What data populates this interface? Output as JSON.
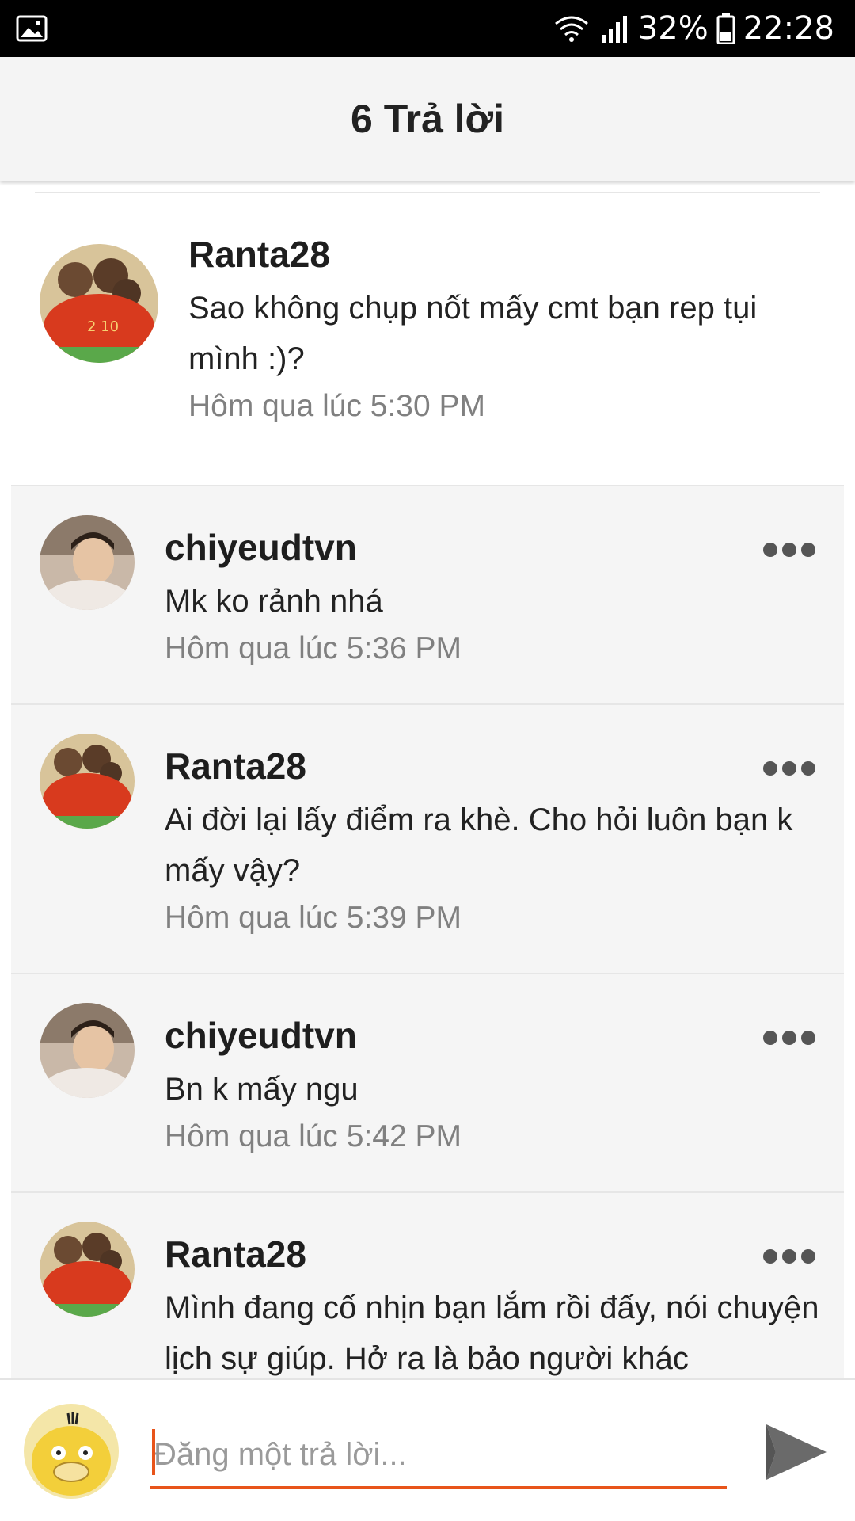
{
  "status_bar": {
    "battery": "32%",
    "time": "22:28",
    "icons": [
      "image-icon",
      "wifi-icon",
      "signal-icon",
      "battery-icon"
    ]
  },
  "header": {
    "title": "6 Trả lời"
  },
  "parent_comment": {
    "username": "Ranta28",
    "message": "Sao không chụp nốt mấy cmt bạn rep tụi mình :)?",
    "time": "Hôm qua lúc 5:30 PM",
    "avatar": "team-photo-avatar"
  },
  "replies": [
    {
      "username": "chiyeudtvn",
      "message": "Mk ko rảnh nhá",
      "time": "Hôm qua lúc 5:36 PM",
      "avatar": "person-avatar"
    },
    {
      "username": "Ranta28",
      "message": "Ai đời lại lấy điểm ra khè. Cho hỏi luôn bạn k mấy vậy?",
      "time": "Hôm qua lúc 5:39 PM",
      "avatar": "team-photo-avatar"
    },
    {
      "username": "chiyeudtvn",
      "message": "Bn k mấy ngu",
      "time": "Hôm qua lúc 5:42 PM",
      "avatar": "person-avatar"
    },
    {
      "username": "Ranta28",
      "message": "Mình đang cố nhịn bạn lắm rồi đấy, nói chuyện lịch sự giúp. Hở ra là bảo người khác",
      "time": "",
      "avatar": "team-photo-avatar"
    }
  ],
  "composer": {
    "placeholder": "Đăng một trả lời...",
    "avatar": "duck-avatar"
  },
  "colors": {
    "accent": "#e8541a",
    "header_bg": "#f4f4f4",
    "reply_bg": "#f5f5f5"
  }
}
